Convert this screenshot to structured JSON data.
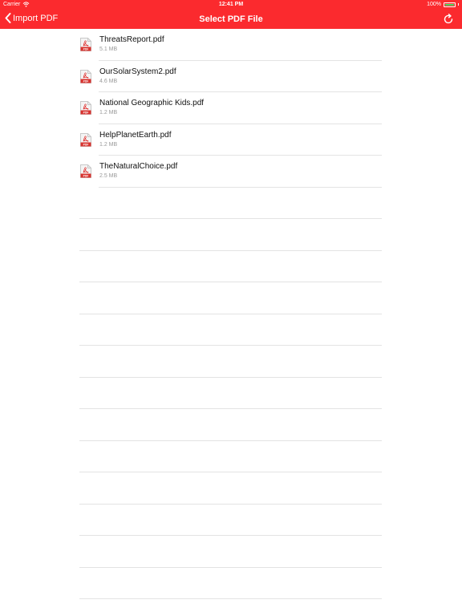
{
  "status_bar": {
    "carrier": "Carrier",
    "time": "12:41 PM",
    "battery": "100%"
  },
  "nav": {
    "back_label": "Import PDF",
    "title": "Select PDF File"
  },
  "files": [
    {
      "name": "ThreatsReport.pdf",
      "size": "5.1 MB"
    },
    {
      "name": "OurSolarSystem2.pdf",
      "size": "4.6 MB"
    },
    {
      "name": "National Geographic Kids.pdf",
      "size": "1.2 MB"
    },
    {
      "name": "HelpPlanetEarth.pdf",
      "size": "1.2 MB"
    },
    {
      "name": "TheNaturalChoice.pdf",
      "size": "2.5 MB"
    }
  ],
  "icons": {
    "back": "chevron-left-icon",
    "refresh": "refresh-icon",
    "file": "pdf-file-icon",
    "wifi": "wifi-icon",
    "battery": "battery-icon"
  },
  "colors": {
    "accent": "#fb2a2e",
    "battery_fill": "#4cd964",
    "separator": "#e3e3e3"
  }
}
